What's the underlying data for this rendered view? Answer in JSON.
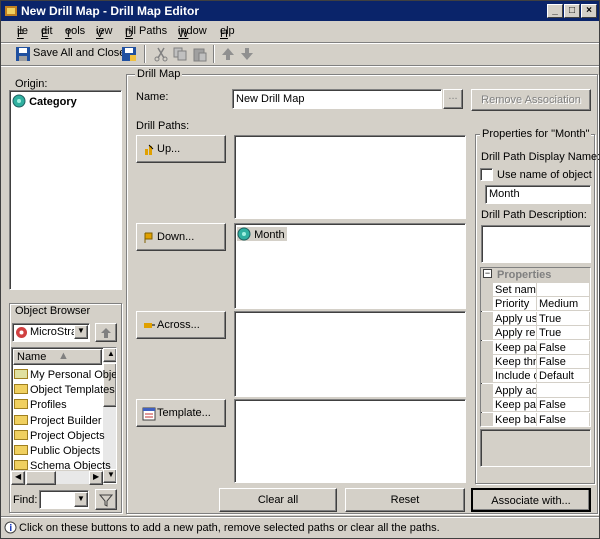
{
  "window": {
    "title": "New Drill Map - Drill Map Editor"
  },
  "menu": [
    "File",
    "Edit",
    "Tools",
    "View",
    "Drill Paths",
    "Window",
    "Help"
  ],
  "toolbar": {
    "save_all_close": "Save All and Close"
  },
  "origin": {
    "label": "Origin:",
    "item": "Category"
  },
  "object_browser": {
    "label": "Object Browser",
    "combo": "MicroStrat",
    "column_name": "Name",
    "items": [
      "My Personal Obje",
      "Object Templates",
      "Profiles",
      "Project Builder",
      "Project Objects",
      "Public Objects",
      "Schema Objects"
    ],
    "find_label": "Find:"
  },
  "drill_map": {
    "group_label": "Drill Map",
    "name_label": "Name:",
    "name_value": "New Drill Map",
    "browse_label": "...",
    "remove_association": "Remove Association",
    "drill_paths_label": "Drill Paths:",
    "up_label": "Up...",
    "down_label": "Down...",
    "across_label": "Across...",
    "template_label": "Template...",
    "down_item": "Month"
  },
  "properties": {
    "group_label": "Properties for \"Month\"",
    "display_name_label": "Drill Path Display Name:",
    "use_name_label": "Use name of object",
    "display_name_value": "Month",
    "description_label": "Drill Path Description:",
    "grid_header": "Properties",
    "rows": [
      {
        "name": "Set name",
        "value": ""
      },
      {
        "name": "Priority",
        "value": "Medium"
      },
      {
        "name": "Apply use",
        "value": "True"
      },
      {
        "name": "Apply rep",
        "value": "True"
      },
      {
        "name": "Keep pare",
        "value": "False"
      },
      {
        "name": "Keep thre",
        "value": "False"
      },
      {
        "name": "Include o",
        "value": "Default"
      },
      {
        "name": "Apply adc",
        "value": ""
      },
      {
        "name": "Keep pag",
        "value": "False"
      },
      {
        "name": "Keep bas",
        "value": "False"
      }
    ]
  },
  "buttons": {
    "clear_all": "Clear all",
    "reset": "Reset",
    "associate": "Associate with..."
  },
  "status": {
    "text": "Click on these buttons to add a new path, remove selected paths or clear all the paths."
  }
}
